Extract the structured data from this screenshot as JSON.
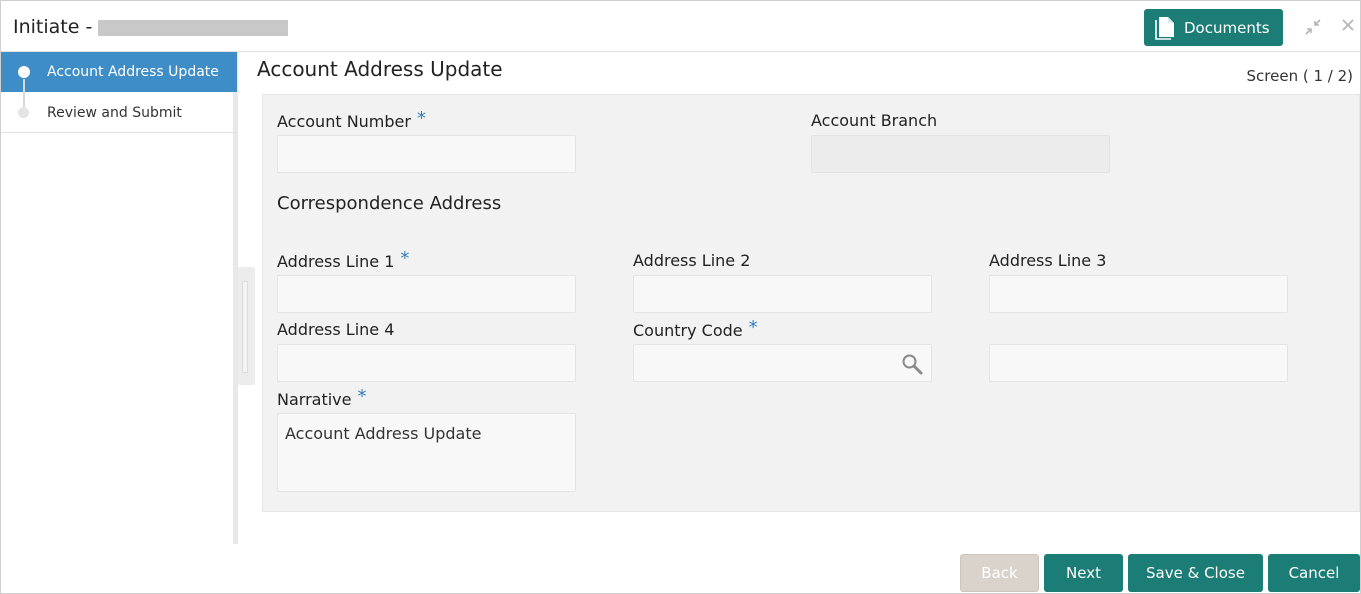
{
  "header": {
    "title": "Initiate -",
    "documents_label": "Documents"
  },
  "sidebar": {
    "steps": [
      {
        "label": "Account Address Update",
        "active": true
      },
      {
        "label": "Review and Submit",
        "active": false
      }
    ]
  },
  "main": {
    "page_title": "Account Address Update",
    "screen_indicator": "Screen ( 1 / 2)",
    "fields": {
      "account_number": {
        "label": "Account Number",
        "required": "*",
        "value": ""
      },
      "account_branch": {
        "label": "Account Branch",
        "value": ""
      },
      "correspondence_title": "Correspondence Address",
      "address_line_1": {
        "label": "Address Line 1",
        "required": "*",
        "value": ""
      },
      "address_line_2": {
        "label": "Address Line 2",
        "value": ""
      },
      "address_line_3": {
        "label": "Address Line 3",
        "value": ""
      },
      "address_line_4": {
        "label": "Address Line 4",
        "value": ""
      },
      "country_code": {
        "label": "Country Code",
        "required": "*",
        "value": ""
      },
      "country_name": {
        "value": ""
      },
      "narrative": {
        "label": "Narrative",
        "required": "*",
        "value": "Account Address Update"
      }
    }
  },
  "footer": {
    "back_label": "Back",
    "next_label": "Next",
    "save_close_label": "Save & Close",
    "cancel_label": "Cancel"
  },
  "colors": {
    "primary": "#1c7c76",
    "active_step": "#3e8dc7",
    "required": "#2f7dc2"
  }
}
